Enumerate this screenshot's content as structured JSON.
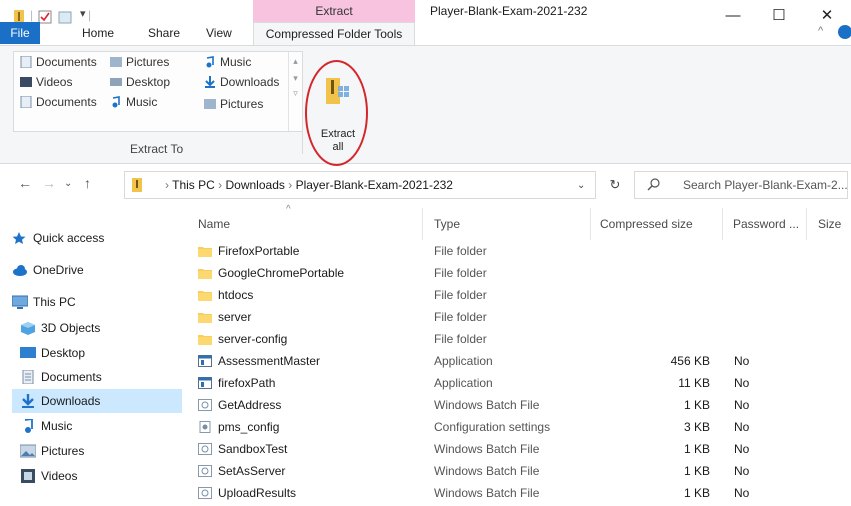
{
  "window": {
    "title": "Player-Blank-Exam-2021-232",
    "context_tab": "Extract"
  },
  "tabs": {
    "file": "File",
    "home": "Home",
    "share": "Share",
    "view": "View",
    "compressed": "Compressed Folder Tools"
  },
  "ribbon": {
    "gallery": [
      {
        "label": "Documents",
        "icon": "documents-icon"
      },
      {
        "label": "Pictures",
        "icon": "pictures-icon"
      },
      {
        "label": "Music",
        "icon": "music-icon"
      },
      {
        "label": "Videos",
        "icon": "videos-icon"
      },
      {
        "label": "Desktop",
        "icon": "desktop-icon"
      },
      {
        "label": "Downloads",
        "icon": "downloads-icon"
      },
      {
        "label": "Documents",
        "icon": "documents-icon"
      },
      {
        "label": "Music",
        "icon": "music-icon"
      },
      {
        "label": "Pictures",
        "icon": "pictures-icon"
      }
    ],
    "group_label": "Extract To",
    "extract_all": "Extract all"
  },
  "address": {
    "crumbs": [
      "This PC",
      "Downloads",
      "Player-Blank-Exam-2021-232"
    ],
    "search_placeholder": "Search Player-Blank-Exam-2..."
  },
  "nav": {
    "items": [
      {
        "label": "Quick access",
        "icon": "star-icon"
      },
      {
        "label": "OneDrive",
        "icon": "cloud-icon"
      },
      {
        "label": "This PC",
        "icon": "pc-icon"
      },
      {
        "label": "3D Objects",
        "icon": "3d-objects-icon"
      },
      {
        "label": "Desktop",
        "icon": "desktop-icon"
      },
      {
        "label": "Documents",
        "icon": "documents-icon"
      },
      {
        "label": "Downloads",
        "icon": "downloads-icon"
      },
      {
        "label": "Music",
        "icon": "music-icon"
      },
      {
        "label": "Pictures",
        "icon": "pictures-icon"
      },
      {
        "label": "Videos",
        "icon": "videos-icon"
      }
    ],
    "selected": "Downloads"
  },
  "columns": {
    "name": "Name",
    "type": "Type",
    "compressed_size": "Compressed size",
    "password": "Password ...",
    "size": "Size"
  },
  "files": [
    {
      "name": "FirefoxPortable",
      "type": "File folder",
      "csize": "",
      "pwd": "",
      "icon": "folder-icon"
    },
    {
      "name": "GoogleChromePortable",
      "type": "File folder",
      "csize": "",
      "pwd": "",
      "icon": "folder-icon"
    },
    {
      "name": "htdocs",
      "type": "File folder",
      "csize": "",
      "pwd": "",
      "icon": "folder-icon"
    },
    {
      "name": "server",
      "type": "File folder",
      "csize": "",
      "pwd": "",
      "icon": "folder-icon"
    },
    {
      "name": "server-config",
      "type": "File folder",
      "csize": "",
      "pwd": "",
      "icon": "folder-icon"
    },
    {
      "name": "AssessmentMaster",
      "type": "Application",
      "csize": "456 KB",
      "pwd": "No",
      "icon": "application-icon"
    },
    {
      "name": "firefoxPath",
      "type": "Application",
      "csize": "11 KB",
      "pwd": "No",
      "icon": "application-icon"
    },
    {
      "name": "GetAddress",
      "type": "Windows Batch File",
      "csize": "1 KB",
      "pwd": "No",
      "icon": "batch-file-icon"
    },
    {
      "name": "pms_config",
      "type": "Configuration settings",
      "csize": "3 KB",
      "pwd": "No",
      "icon": "config-file-icon"
    },
    {
      "name": "SandboxTest",
      "type": "Windows Batch File",
      "csize": "1 KB",
      "pwd": "No",
      "icon": "batch-file-icon"
    },
    {
      "name": "SetAsServer",
      "type": "Windows Batch File",
      "csize": "1 KB",
      "pwd": "No",
      "icon": "batch-file-icon"
    },
    {
      "name": "UploadResults",
      "type": "Windows Batch File",
      "csize": "1 KB",
      "pwd": "No",
      "icon": "batch-file-icon"
    }
  ]
}
